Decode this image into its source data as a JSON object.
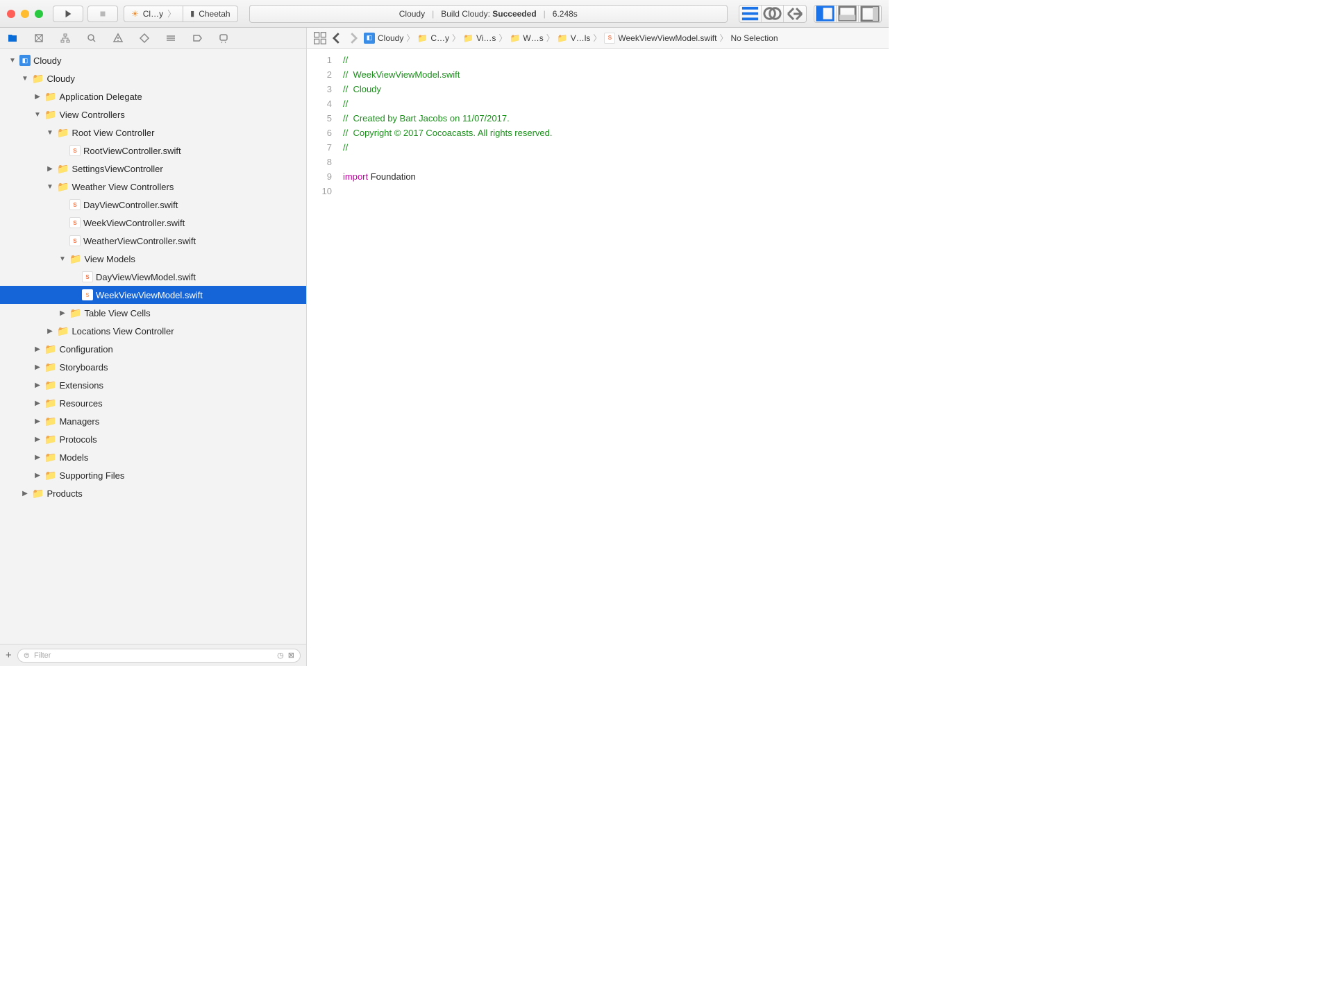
{
  "toolbar": {
    "scheme_name": "Cl…y",
    "device_name": "Cheetah",
    "status_project": "Cloudy",
    "status_action": "Build Cloudy:",
    "status_result": "Succeeded",
    "status_time": "6.248s"
  },
  "tree": {
    "project": "Cloudy",
    "items": [
      {
        "indent": 0,
        "disc": "down",
        "icon": "proj",
        "label": "Cloudy"
      },
      {
        "indent": 1,
        "disc": "down",
        "icon": "folder",
        "label": "Cloudy"
      },
      {
        "indent": 2,
        "disc": "right",
        "icon": "folder",
        "label": "Application Delegate"
      },
      {
        "indent": 2,
        "disc": "down",
        "icon": "folder",
        "label": "View Controllers"
      },
      {
        "indent": 3,
        "disc": "down",
        "icon": "folder",
        "label": "Root View Controller"
      },
      {
        "indent": 4,
        "disc": "",
        "icon": "swift",
        "label": "RootViewController.swift"
      },
      {
        "indent": 3,
        "disc": "right",
        "icon": "folder",
        "label": "SettingsViewController"
      },
      {
        "indent": 3,
        "disc": "down",
        "icon": "folder",
        "label": "Weather View Controllers"
      },
      {
        "indent": 4,
        "disc": "",
        "icon": "swift",
        "label": "DayViewController.swift"
      },
      {
        "indent": 4,
        "disc": "",
        "icon": "swift",
        "label": "WeekViewController.swift"
      },
      {
        "indent": 4,
        "disc": "",
        "icon": "swift",
        "label": "WeatherViewController.swift"
      },
      {
        "indent": 4,
        "disc": "down",
        "icon": "folder",
        "label": "View Models"
      },
      {
        "indent": 5,
        "disc": "",
        "icon": "swift",
        "label": "DayViewViewModel.swift"
      },
      {
        "indent": 5,
        "disc": "",
        "icon": "swift",
        "label": "WeekViewViewModel.swift",
        "selected": true
      },
      {
        "indent": 4,
        "disc": "right",
        "icon": "folder",
        "label": "Table View Cells"
      },
      {
        "indent": 3,
        "disc": "right",
        "icon": "folder",
        "label": "Locations View Controller"
      },
      {
        "indent": 2,
        "disc": "right",
        "icon": "folder",
        "label": "Configuration"
      },
      {
        "indent": 2,
        "disc": "right",
        "icon": "folder",
        "label": "Storyboards"
      },
      {
        "indent": 2,
        "disc": "right",
        "icon": "folder",
        "label": "Extensions"
      },
      {
        "indent": 2,
        "disc": "right",
        "icon": "folder",
        "label": "Resources"
      },
      {
        "indent": 2,
        "disc": "right",
        "icon": "folder",
        "label": "Managers"
      },
      {
        "indent": 2,
        "disc": "right",
        "icon": "folder",
        "label": "Protocols"
      },
      {
        "indent": 2,
        "disc": "right",
        "icon": "folder",
        "label": "Models"
      },
      {
        "indent": 2,
        "disc": "right",
        "icon": "folder",
        "label": "Supporting Files"
      },
      {
        "indent": 1,
        "disc": "right",
        "icon": "folder",
        "label": "Products"
      }
    ]
  },
  "filter": {
    "placeholder": "Filter"
  },
  "jumpbar": {
    "crumbs": [
      {
        "icon": "proj",
        "label": "Cloudy"
      },
      {
        "icon": "folder",
        "label": "C…y"
      },
      {
        "icon": "folder",
        "label": "Vi…s"
      },
      {
        "icon": "folder",
        "label": "W…s"
      },
      {
        "icon": "folder",
        "label": "V…ls"
      },
      {
        "icon": "swift",
        "label": "WeekViewViewModel.swift"
      },
      {
        "icon": "",
        "label": "No Selection"
      }
    ]
  },
  "code": {
    "lines": [
      [
        {
          "c": "comment",
          "t": "//"
        }
      ],
      [
        {
          "c": "comment",
          "t": "//  WeekViewViewModel.swift"
        }
      ],
      [
        {
          "c": "comment",
          "t": "//  Cloudy"
        }
      ],
      [
        {
          "c": "comment",
          "t": "//"
        }
      ],
      [
        {
          "c": "comment",
          "t": "//  Created by Bart Jacobs on 11/07/2017."
        }
      ],
      [
        {
          "c": "comment",
          "t": "//  Copyright © 2017 Cocoacasts. All rights reserved."
        }
      ],
      [
        {
          "c": "comment",
          "t": "//"
        }
      ],
      [],
      [
        {
          "c": "keyword",
          "t": "import"
        },
        {
          "c": "plain",
          "t": " Foundation"
        }
      ],
      []
    ]
  }
}
